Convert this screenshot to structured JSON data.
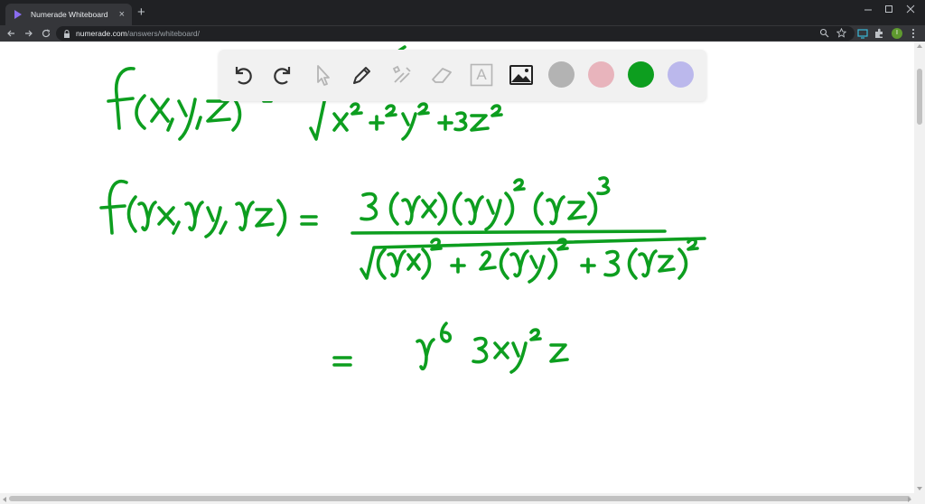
{
  "browser": {
    "tab_title": "Numerade Whiteboard",
    "close_glyph": "×",
    "newtab_glyph": "+",
    "url_host": "numerade.com",
    "url_path": "/answers/whiteboard/",
    "profile_initial": "I"
  },
  "whiteboard": {
    "tools": [
      "undo-icon",
      "redo-icon",
      "pointer-icon",
      "pen-icon",
      "tools-icon",
      "eraser-icon",
      "text-icon",
      "image-icon"
    ],
    "text_tool_glyph": "A",
    "colors": [
      "#b3b3b3",
      "#e8b4bc",
      "#0d9e1f",
      "#bbb8ec"
    ],
    "selected_color": "#0d9e1f"
  }
}
